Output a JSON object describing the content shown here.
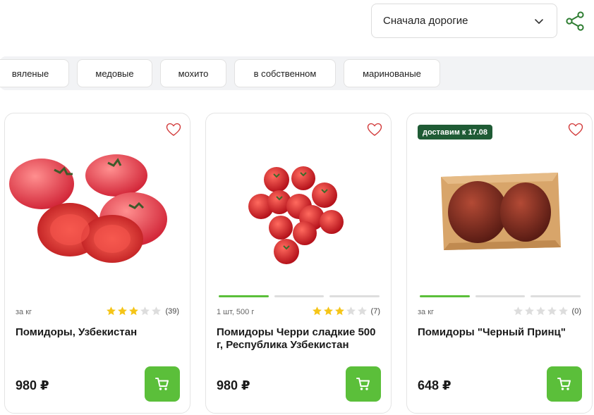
{
  "sort": {
    "selected": "Сначала дорогие"
  },
  "filters": [
    {
      "label": "вяленые"
    },
    {
      "label": "медовые"
    },
    {
      "label": "мохито"
    },
    {
      "label": "в собственном"
    },
    {
      "label": "маринованые"
    }
  ],
  "products": [
    {
      "badge": "",
      "unit": "за кг",
      "rating": 3,
      "rating_count": "(39)",
      "title": "Помидоры, Узбекистан",
      "price": "980 ₽",
      "image_icon": "pink-tomatoes-image",
      "gallery_slides": 0
    },
    {
      "badge": "",
      "unit": "1 шт, 500 г",
      "rating": 3,
      "rating_count": "(7)",
      "title": "Помидоры Черри сладкие 500 г, Республика Узбекистан",
      "price": "980 ₽",
      "image_icon": "cherry-tomatoes-image",
      "gallery_slides": 3
    },
    {
      "badge": "доставим к 17.08",
      "unit": "за кг",
      "rating": 0,
      "rating_count": "(0)",
      "title": "Помидоры \"Черный Принц\"",
      "price": "648 ₽",
      "image_icon": "black-prince-tomatoes-image",
      "gallery_slides": 3
    }
  ],
  "colors": {
    "accent": "#5bbf3a",
    "badge": "#1f5b35",
    "star_on": "#f5c518",
    "star_off": "#dddddd",
    "heart": "#d23b3b"
  }
}
